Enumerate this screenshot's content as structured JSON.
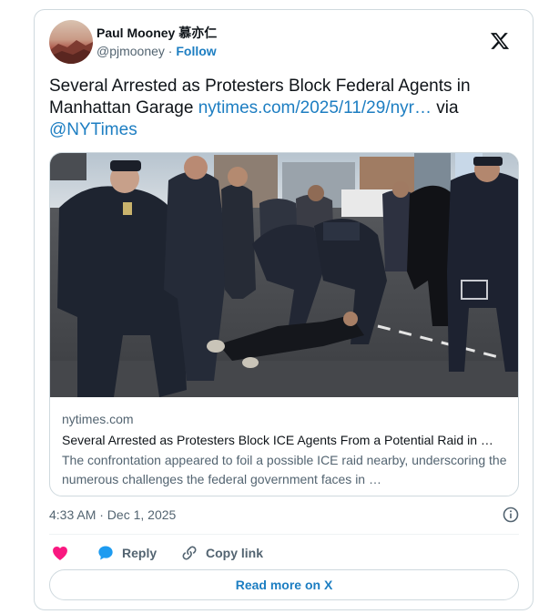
{
  "author": {
    "name": "Paul Mooney 慕亦仁",
    "handle": "@pjmooney",
    "separator": " · ",
    "follow_label": "Follow"
  },
  "tweet": {
    "text": "Several Arrested as Protesters Block Federal Agents in Manhattan Garage ",
    "link": "nytimes.com/2025/11/29/nyr…",
    "via": " via ",
    "mention": "@NYTimes"
  },
  "link_card": {
    "domain": "nytimes.com",
    "title": "Several Arrested as Protesters Block ICE Agents From a Potential Raid in …",
    "description": "The confrontation appeared to foil a possible ICE raid nearby, underscoring the numerous challenges the federal government faces in …"
  },
  "timestamp": "4:33 AM · Dec 1, 2025",
  "actions": {
    "like_label": "",
    "reply_label": "Reply",
    "copy_link_label": "Copy link"
  },
  "read_more_label": "Read more on X",
  "icons": {
    "brand": "x-logo-icon",
    "like": "heart-icon",
    "reply": "speech-bubble-icon",
    "copy": "link-icon",
    "info": "info-icon"
  },
  "colors": {
    "accent": "#1d7ec2",
    "like": "#f91880",
    "reply": "#1d9bf0",
    "muted": "#536471",
    "border": "#cfd9de"
  }
}
